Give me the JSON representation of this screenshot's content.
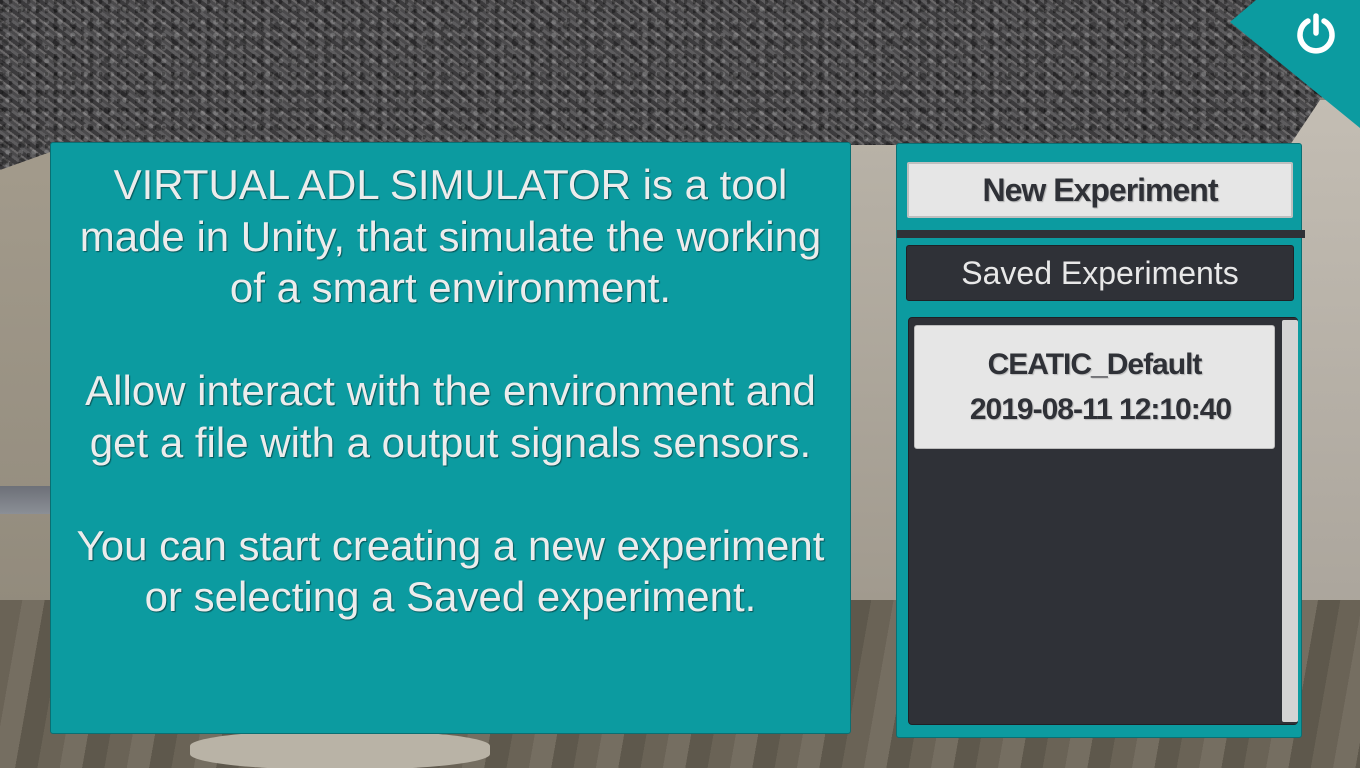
{
  "info": {
    "paragraph1": "VIRTUAL ADL SIMULATOR is a tool made in Unity, that simulate the working of a smart environment.",
    "paragraph2": "Allow interact with the environment and get a file with a output signals sensors.",
    "paragraph3": "You can start creating a new experiment or selecting a Saved experiment."
  },
  "sidebar": {
    "new_experiment_label": "New Experiment",
    "saved_header": "Saved Experiments",
    "saved_items": [
      {
        "name": "CEATIC_Default",
        "date": "2019-08-11 12:10:40"
      }
    ]
  },
  "power": {
    "icon": "power-icon"
  },
  "colors": {
    "accent": "#0c9ba0",
    "dark": "#2f3137",
    "light_button": "#e6e6e6",
    "text_light": "#ececec"
  }
}
